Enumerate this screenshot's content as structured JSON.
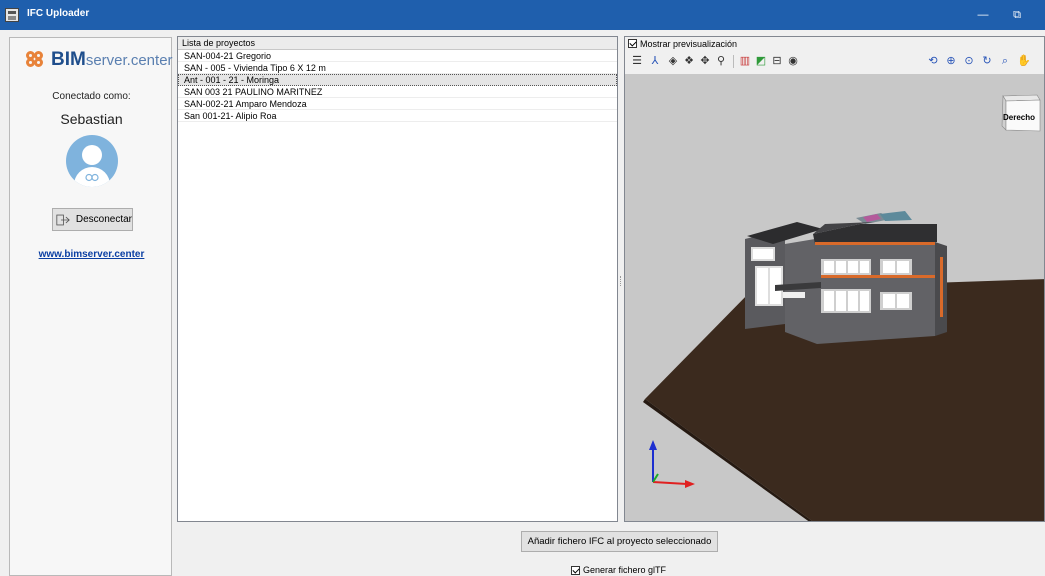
{
  "window": {
    "title": "IFC Uploader",
    "minimize_glyph": "—",
    "restore_glyph": "⧉"
  },
  "sidebar": {
    "logo_bim": "BIM",
    "logo_rest": "server.center",
    "connected_label": "Conectado como:",
    "user_name": "Sebastian",
    "logout_label": "Desconectar",
    "link_text": "www.bimserver.center"
  },
  "projects": {
    "header": "Lista de proyectos",
    "items": [
      "SAN-004-21 Gregorio",
      "SAN - 005 - Vivienda Tipo  6 X 12 m",
      "Ant - 001 - 21 - Moringa",
      "SAN 003 21 PAULINO MARITNEZ",
      "SAN-002-21 Amparo Mendoza",
      "San 001-21- Alipio Roa"
    ],
    "selected_index": 2
  },
  "viewer": {
    "preview_label": "Mostrar previsualización",
    "preview_checked": true,
    "view_cube_label": "Derecho"
  },
  "actions": {
    "add_ifc_label": "Añadir fichero IFC al proyecto seleccionado",
    "gltf_label": "Generar fichero glTF",
    "gltf_checked": true
  },
  "colors": {
    "titlebar": "#1f5fad",
    "brand_orange": "#e8833a",
    "brand_blue": "#1f4e8c",
    "link": "#0b3fa3",
    "ground": "#3b2a1e"
  }
}
